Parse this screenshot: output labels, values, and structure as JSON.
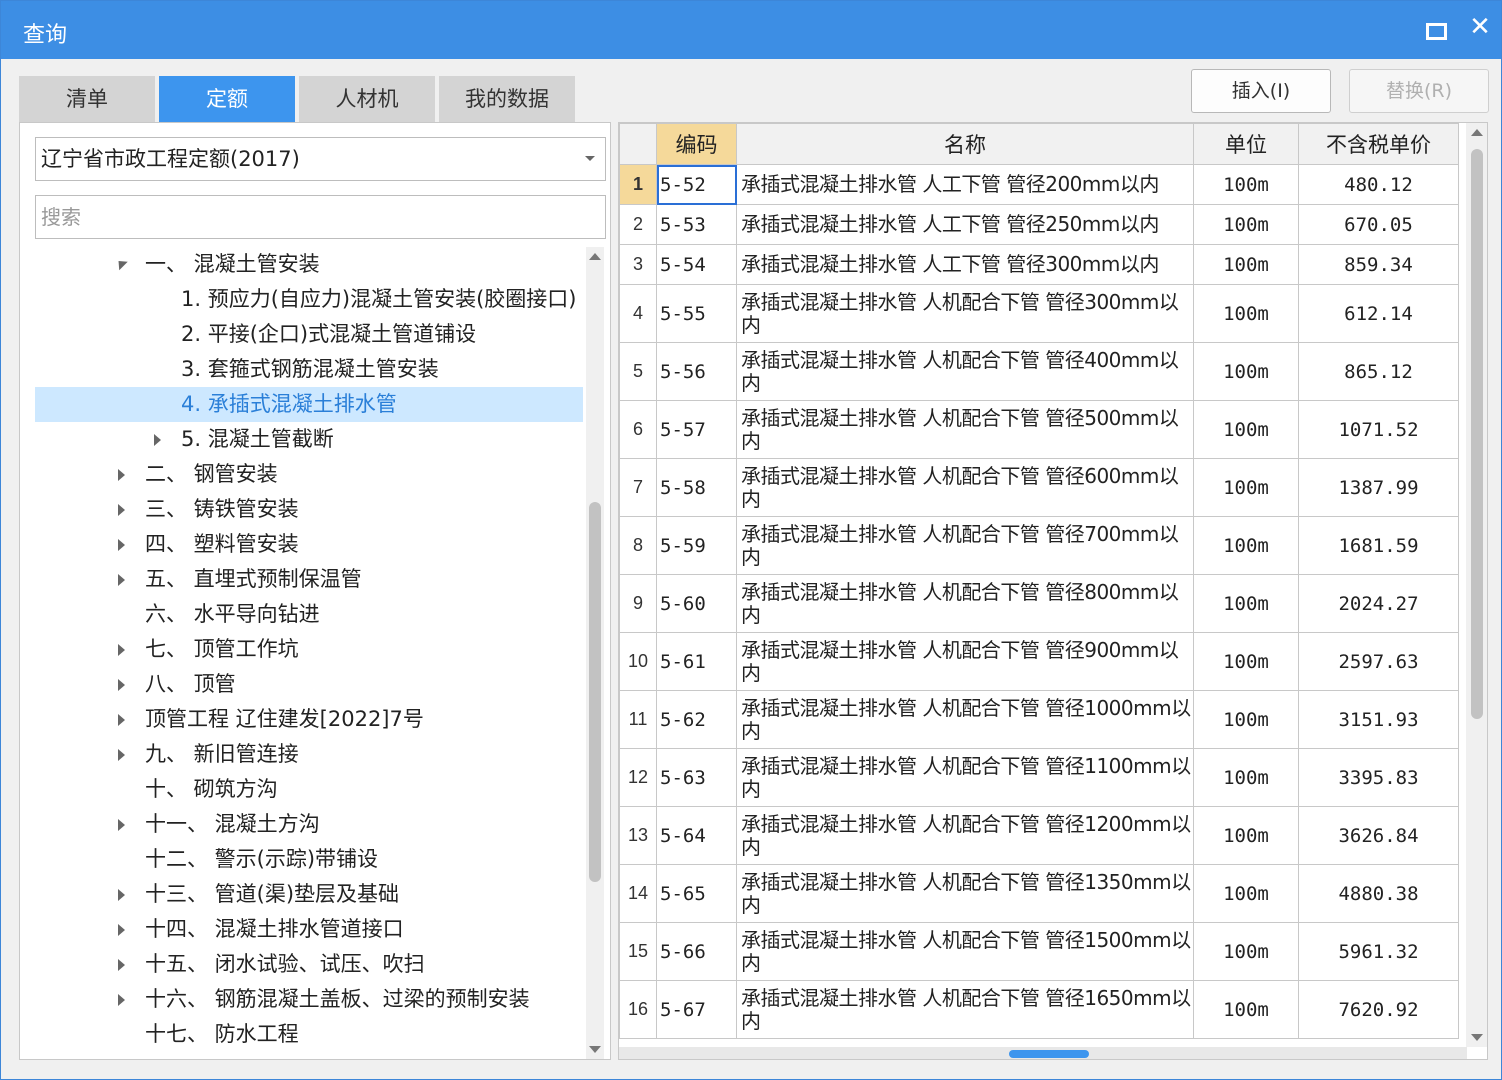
{
  "window": {
    "title": "查询",
    "close_glyph": "✕"
  },
  "tabs": [
    {
      "label": "清单",
      "active": false
    },
    {
      "label": "定额",
      "active": true
    },
    {
      "label": "人材机",
      "active": false
    },
    {
      "label": "我的数据",
      "active": false
    }
  ],
  "actions": {
    "insert_label": "插入(I)",
    "replace_label": "替换(R)"
  },
  "left": {
    "library_select": "辽宁省市政工程定额(2017)",
    "search_placeholder": "搜索",
    "tree": [
      {
        "label": "一、 混凝土管安装",
        "level": 0,
        "toggle": "expanded"
      },
      {
        "label": "1. 预应力(自应力)混凝土管安装(胶圈接口)",
        "level": 1,
        "toggle": "none"
      },
      {
        "label": "2. 平接(企口)式混凝土管道铺设",
        "level": 1,
        "toggle": "none"
      },
      {
        "label": "3. 套箍式钢筋混凝土管安装",
        "level": 1,
        "toggle": "none"
      },
      {
        "label": "4. 承插式混凝土排水管",
        "level": 1,
        "toggle": "none",
        "selected": true
      },
      {
        "label": "5. 混凝土管截断",
        "level": 1,
        "toggle": "collapsed"
      },
      {
        "label": "二、 钢管安装",
        "level": 0,
        "toggle": "collapsed"
      },
      {
        "label": "三、 铸铁管安装",
        "level": 0,
        "toggle": "collapsed"
      },
      {
        "label": "四、 塑料管安装",
        "level": 0,
        "toggle": "collapsed"
      },
      {
        "label": "五、 直埋式预制保温管",
        "level": 0,
        "toggle": "collapsed"
      },
      {
        "label": "六、 水平导向钻进",
        "level": 0,
        "toggle": "none"
      },
      {
        "label": "七、 顶管工作坑",
        "level": 0,
        "toggle": "collapsed"
      },
      {
        "label": "八、 顶管",
        "level": 0,
        "toggle": "collapsed"
      },
      {
        "label": "顶管工程 辽住建发[2022]7号",
        "level": 0,
        "toggle": "collapsed"
      },
      {
        "label": "九、 新旧管连接",
        "level": 0,
        "toggle": "collapsed"
      },
      {
        "label": "十、 砌筑方沟",
        "level": 0,
        "toggle": "none"
      },
      {
        "label": "十一、 混凝土方沟",
        "level": 0,
        "toggle": "collapsed"
      },
      {
        "label": "十二、 警示(示踪)带铺设",
        "level": 0,
        "toggle": "none"
      },
      {
        "label": "十三、 管道(渠)垫层及基础",
        "level": 0,
        "toggle": "collapsed"
      },
      {
        "label": "十四、 混凝土排水管道接口",
        "level": 0,
        "toggle": "collapsed"
      },
      {
        "label": "十五、 闭水试验、试压、吹扫",
        "level": 0,
        "toggle": "collapsed"
      },
      {
        "label": "十六、 钢筋混凝土盖板、过梁的预制安装",
        "level": 0,
        "toggle": "collapsed"
      },
      {
        "label": "十七、 防水工程",
        "level": 0,
        "toggle": "none"
      }
    ]
  },
  "grid": {
    "columns": [
      "",
      "编码",
      "名称",
      "单位",
      "不含税单价"
    ],
    "rows": [
      {
        "idx": "1",
        "code": "5-52",
        "name": "承插式混凝土排水管 人工下管 管径200mm以内",
        "unit": "100m",
        "price": "480.12"
      },
      {
        "idx": "2",
        "code": "5-53",
        "name": "承插式混凝土排水管 人工下管 管径250mm以内",
        "unit": "100m",
        "price": "670.05"
      },
      {
        "idx": "3",
        "code": "5-54",
        "name": "承插式混凝土排水管 人工下管 管径300mm以内",
        "unit": "100m",
        "price": "859.34"
      },
      {
        "idx": "4",
        "code": "5-55",
        "name": "承插式混凝土排水管 人机配合下管 管径300mm以内",
        "unit": "100m",
        "price": "612.14"
      },
      {
        "idx": "5",
        "code": "5-56",
        "name": "承插式混凝土排水管 人机配合下管 管径400mm以内",
        "unit": "100m",
        "price": "865.12"
      },
      {
        "idx": "6",
        "code": "5-57",
        "name": "承插式混凝土排水管 人机配合下管 管径500mm以内",
        "unit": "100m",
        "price": "1071.52"
      },
      {
        "idx": "7",
        "code": "5-58",
        "name": "承插式混凝土排水管 人机配合下管 管径600mm以内",
        "unit": "100m",
        "price": "1387.99"
      },
      {
        "idx": "8",
        "code": "5-59",
        "name": "承插式混凝土排水管 人机配合下管 管径700mm以内",
        "unit": "100m",
        "price": "1681.59"
      },
      {
        "idx": "9",
        "code": "5-60",
        "name": "承插式混凝土排水管 人机配合下管 管径800mm以内",
        "unit": "100m",
        "price": "2024.27"
      },
      {
        "idx": "10",
        "code": "5-61",
        "name": "承插式混凝土排水管 人机配合下管 管径900mm以内",
        "unit": "100m",
        "price": "2597.63"
      },
      {
        "idx": "11",
        "code": "5-62",
        "name": "承插式混凝土排水管 人机配合下管 管径1000mm以内",
        "unit": "100m",
        "price": "3151.93"
      },
      {
        "idx": "12",
        "code": "5-63",
        "name": "承插式混凝土排水管 人机配合下管 管径1100mm以内",
        "unit": "100m",
        "price": "3395.83"
      },
      {
        "idx": "13",
        "code": "5-64",
        "name": "承插式混凝土排水管 人机配合下管 管径1200mm以内",
        "unit": "100m",
        "price": "3626.84"
      },
      {
        "idx": "14",
        "code": "5-65",
        "name": "承插式混凝土排水管 人机配合下管 管径1350mm以内",
        "unit": "100m",
        "price": "4880.38"
      },
      {
        "idx": "15",
        "code": "5-66",
        "name": "承插式混凝土排水管 人机配合下管 管径1500mm以内",
        "unit": "100m",
        "price": "5961.32"
      },
      {
        "idx": "16",
        "code": "5-67",
        "name": "承插式混凝土排水管 人机配合下管 管径1650mm以内",
        "unit": "100m",
        "price": "7620.92"
      }
    ]
  }
}
